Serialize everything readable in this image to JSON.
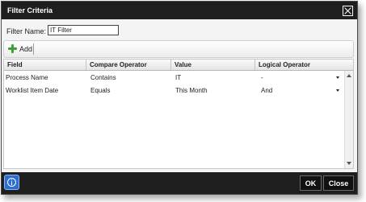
{
  "dialog": {
    "title": "Filter Criteria",
    "close_icon": "close-icon"
  },
  "filter_name": {
    "label": "Filter Name:",
    "value": "IT Filter"
  },
  "toolbar": {
    "add_label": "Add",
    "add_icon": "plus-icon"
  },
  "grid": {
    "columns": [
      "Field",
      "Compare Operator",
      "Value",
      "Logical Operator"
    ],
    "rows": [
      {
        "field": "Process Name",
        "compare_operator": "Contains",
        "value": "IT",
        "logical_operator": "-"
      },
      {
        "field": "Worklist Item Date",
        "compare_operator": "Equals",
        "value": "This Month",
        "logical_operator": "And"
      }
    ]
  },
  "footer": {
    "info_icon": "info-icon",
    "ok_label": "OK",
    "close_label": "Close"
  },
  "colors": {
    "titlebar": "#1e1e1e",
    "footer": "#1e1e1e",
    "add_icon": "#3aa334",
    "info_button": "#2c6fd1"
  }
}
